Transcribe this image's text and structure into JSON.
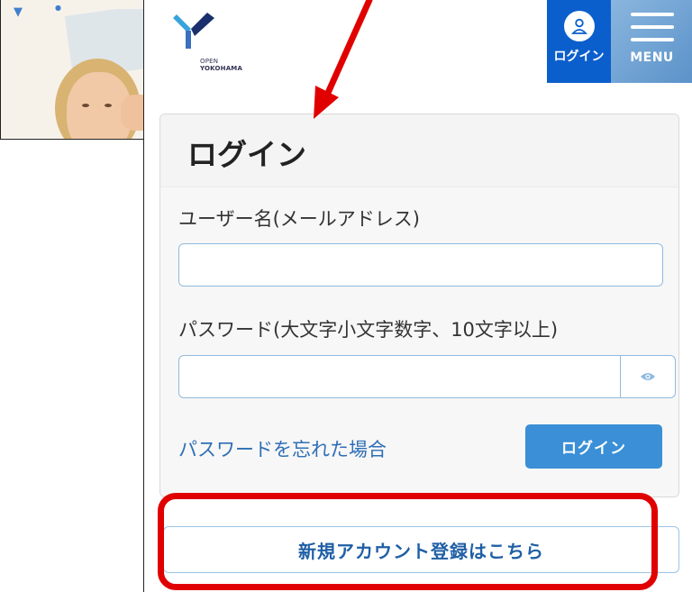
{
  "header": {
    "logo_line1": "OPEN",
    "logo_line2": "YOKOHAMA",
    "login_tab_label": "ログイン",
    "menu_tab_label": "MENU"
  },
  "login_form": {
    "title": "ログイン",
    "username_label": "ユーザー名(メールアドレス)",
    "username_value": "",
    "password_label": "パスワード(大文字小文字数字、10文字以上)",
    "password_value": "",
    "forgot_link": "パスワードを忘れた場合",
    "submit_label": "ログイン"
  },
  "register_button_label": "新規アカウント登録はこちら",
  "colors": {
    "login_tab": "#0b5fcc",
    "accent_button": "#3a8fd6",
    "annotation_red": "#e00000"
  }
}
